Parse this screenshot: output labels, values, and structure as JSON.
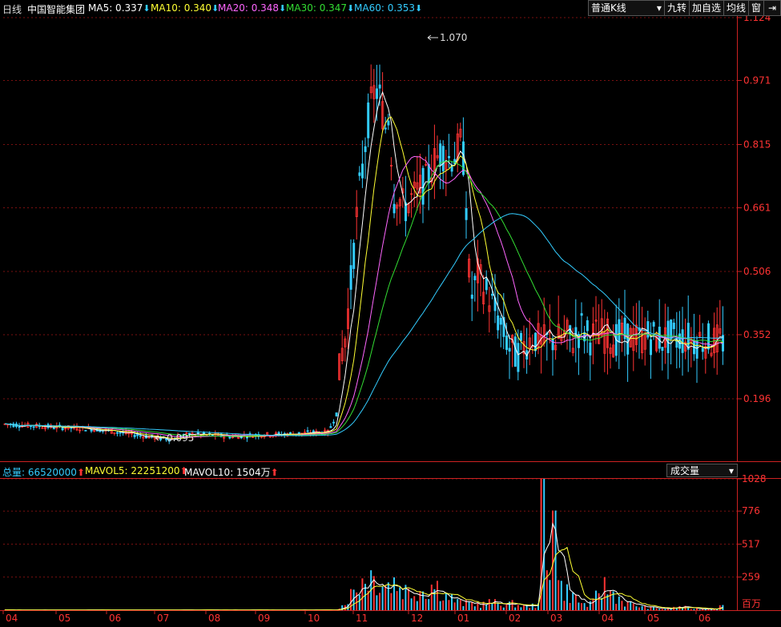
{
  "header": {
    "period_label": "日线",
    "stock_name": "中国智能集团",
    "ma": [
      {
        "label": "MA5: 0.337",
        "color": "#ffffff",
        "trend": "down"
      },
      {
        "label": "MA10: 0.340",
        "color": "#ffff33",
        "trend": "down"
      },
      {
        "label": "MA20: 0.348",
        "color": "#ff66ff",
        "trend": "down"
      },
      {
        "label": "MA30: 0.347",
        "color": "#33dd33",
        "trend": "down"
      },
      {
        "label": "MA60: 0.353",
        "color": "#33ccff",
        "trend": "down"
      }
    ],
    "arrow_down_glyph": "⬇",
    "arrow_up_glyph": "⬆"
  },
  "toolbar": {
    "kline_select": "普通K线",
    "nine_turn": "九转",
    "add_watch": "加自选",
    "avg_line": "均线",
    "window": "窗",
    "pin_icon": "pin-icon"
  },
  "price_axis": {
    "labels": [
      "1.124",
      "0.971",
      "0.815",
      "0.661",
      "0.506",
      "0.352",
      "0.196"
    ]
  },
  "annotations": {
    "high": "1.070",
    "low": "0.095"
  },
  "volume": {
    "total_label": "总量: 66520000",
    "mavol5_label": "MAVOL5: 22251200",
    "mavol10_label": "MAVOL10: 1504万",
    "select_label": "成交量",
    "axis_labels": [
      "1028",
      "776",
      "517",
      "259"
    ],
    "unit": "百万"
  },
  "months": [
    "04",
    "05",
    "06",
    "07",
    "08",
    "09",
    "10",
    "11",
    "12",
    "01",
    "02",
    "03",
    "04",
    "05",
    "06"
  ],
  "colors": {
    "up": "#ff3333",
    "down": "#33ccff",
    "grid": "#7a1010",
    "axis": "#cc2222",
    "background": "#000000"
  },
  "chart_data": {
    "type": "candlestick",
    "price_ylim": [
      0.04,
      1.124
    ],
    "vol_ylim": [
      0,
      1028
    ],
    "price_ticks": [
      1.124,
      0.971,
      0.815,
      0.661,
      0.506,
      0.352,
      0.196
    ],
    "vol_ticks": [
      1028,
      776,
      517,
      259
    ],
    "high_mark": 1.07,
    "low_mark": 0.095,
    "ma_last": {
      "MA5": 0.337,
      "MA10": 0.34,
      "MA20": 0.348,
      "MA30": 0.347,
      "MA60": 0.353
    },
    "mavol_last": {
      "MAVOL5": 22251200,
      "MAVOL10": "1504万"
    },
    "total_volume_last": 66520000,
    "price_path": [
      [
        0,
        0.135
      ],
      [
        60,
        0.128
      ],
      [
        120,
        0.122
      ],
      [
        170,
        0.108
      ],
      [
        200,
        0.1
      ],
      [
        215,
        0.098
      ],
      [
        225,
        0.105
      ],
      [
        240,
        0.11
      ],
      [
        260,
        0.108
      ],
      [
        290,
        0.104
      ],
      [
        320,
        0.108
      ],
      [
        360,
        0.11
      ],
      [
        395,
        0.114
      ],
      [
        410,
        0.114
      ],
      [
        420,
        0.16
      ],
      [
        425,
        0.3
      ],
      [
        430,
        0.33
      ],
      [
        435,
        0.42
      ],
      [
        440,
        0.52
      ],
      [
        447,
        0.68
      ],
      [
        453,
        0.76
      ],
      [
        458,
        0.86
      ],
      [
        463,
        0.91
      ],
      [
        468,
        0.95
      ],
      [
        473,
        0.94
      ],
      [
        477,
        0.9
      ],
      [
        482,
        0.85
      ],
      [
        486,
        0.9
      ],
      [
        491,
        0.68
      ],
      [
        496,
        0.7
      ],
      [
        501,
        0.67
      ],
      [
        506,
        0.66
      ],
      [
        513,
        0.68
      ],
      [
        521,
        0.7
      ],
      [
        531,
        0.72
      ],
      [
        541,
        0.77
      ],
      [
        551,
        0.8
      ],
      [
        561,
        0.78
      ],
      [
        569,
        0.79
      ],
      [
        575,
        0.82
      ],
      [
        580,
        0.76
      ],
      [
        586,
        0.48
      ],
      [
        590,
        0.44
      ],
      [
        596,
        0.5
      ],
      [
        606,
        0.46
      ],
      [
        616,
        0.42
      ],
      [
        626,
        0.37
      ],
      [
        636,
        0.32
      ],
      [
        645,
        0.3
      ],
      [
        656,
        0.33
      ],
      [
        666,
        0.35
      ],
      [
        676,
        0.33
      ],
      [
        686,
        0.34
      ],
      [
        696,
        0.34
      ],
      [
        706,
        0.35
      ],
      [
        716,
        0.34
      ],
      [
        726,
        0.37
      ],
      [
        736,
        0.345
      ],
      [
        746,
        0.355
      ],
      [
        757,
        0.35
      ],
      [
        767,
        0.34
      ],
      [
        777,
        0.35
      ],
      [
        787,
        0.345
      ],
      [
        797,
        0.34
      ],
      [
        807,
        0.35
      ],
      [
        817,
        0.345
      ],
      [
        827,
        0.34
      ],
      [
        837,
        0.345
      ],
      [
        847,
        0.342
      ],
      [
        857,
        0.345
      ],
      [
        867,
        0.338
      ],
      [
        877,
        0.34
      ],
      [
        887,
        0.335
      ],
      [
        897,
        0.337
      ]
    ],
    "volume_path": [
      [
        0,
        2
      ],
      [
        420,
        2
      ],
      [
        428,
        40
      ],
      [
        436,
        110
      ],
      [
        444,
        170
      ],
      [
        452,
        230
      ],
      [
        460,
        290
      ],
      [
        468,
        250
      ],
      [
        476,
        230
      ],
      [
        484,
        200
      ],
      [
        492,
        220
      ],
      [
        500,
        180
      ],
      [
        508,
        150
      ],
      [
        516,
        140
      ],
      [
        524,
        170
      ],
      [
        532,
        150
      ],
      [
        540,
        200
      ],
      [
        548,
        180
      ],
      [
        556,
        120
      ],
      [
        564,
        90
      ],
      [
        572,
        60
      ],
      [
        580,
        50
      ],
      [
        590,
        55
      ],
      [
        600,
        40
      ],
      [
        610,
        60
      ],
      [
        620,
        55
      ],
      [
        630,
        45
      ],
      [
        640,
        50
      ],
      [
        650,
        35
      ],
      [
        660,
        30
      ],
      [
        670,
        40
      ],
      [
        676,
        190
      ],
      [
        684,
        260
      ],
      [
        692,
        300
      ],
      [
        700,
        180
      ],
      [
        708,
        140
      ],
      [
        716,
        110
      ],
      [
        724,
        60
      ],
      [
        732,
        40
      ],
      [
        740,
        50
      ],
      [
        748,
        160
      ],
      [
        756,
        180
      ],
      [
        764,
        140
      ],
      [
        772,
        100
      ],
      [
        780,
        60
      ],
      [
        790,
        40
      ],
      [
        800,
        30
      ],
      [
        810,
        20
      ],
      [
        820,
        15
      ],
      [
        830,
        10
      ],
      [
        840,
        18
      ],
      [
        850,
        30
      ],
      [
        860,
        15
      ],
      [
        870,
        12
      ],
      [
        880,
        10
      ],
      [
        890,
        12
      ],
      [
        897,
        30
      ]
    ]
  }
}
